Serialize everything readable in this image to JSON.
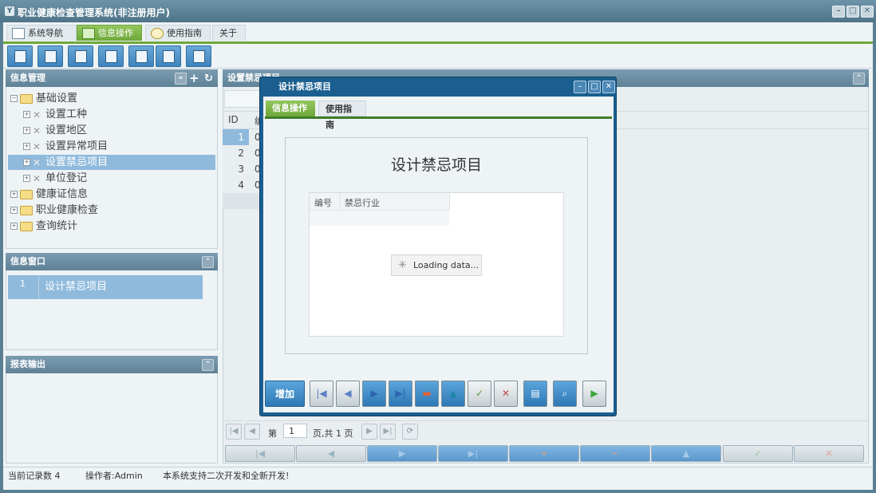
{
  "app": {
    "title": "职业健康检查管理系统(非注册用户)",
    "logo_icon": "app-logo-icon"
  },
  "menu": {
    "tabs": [
      {
        "label": "系统导航",
        "icon": "monitor-icon",
        "active": false
      },
      {
        "label": "信息操作",
        "icon": "grid-icon",
        "active": true
      },
      {
        "label": "使用指南",
        "icon": "help-circle-icon",
        "active": false
      },
      {
        "label": "关于",
        "icon": "",
        "active": false
      }
    ]
  },
  "toolbar": {
    "buttons": [
      "search-doc-icon",
      "book-icon",
      "document-icon",
      "users-icon",
      "window-icon",
      "export-icon",
      "print-icon"
    ]
  },
  "left_panel": {
    "info_manage_title": "信息管理",
    "tree": [
      {
        "label": "基础设置",
        "level": 0,
        "expanded": true,
        "type": "folder"
      },
      {
        "label": "设置工种",
        "level": 1,
        "type": "tool"
      },
      {
        "label": "设置地区",
        "level": 1,
        "type": "tool"
      },
      {
        "label": "设置异常项目",
        "level": 1,
        "type": "tool"
      },
      {
        "label": "设置禁忌项目",
        "level": 1,
        "type": "tool",
        "selected": true
      },
      {
        "label": "单位登记",
        "level": 1,
        "type": "tool"
      },
      {
        "label": "健康证信息",
        "level": 0,
        "type": "folder"
      },
      {
        "label": "职业健康检查",
        "level": 0,
        "type": "folder"
      },
      {
        "label": "查询统计",
        "level": 0,
        "type": "folder"
      }
    ],
    "info_window_title": "信息窗口",
    "info_window_rows": [
      {
        "num": "1",
        "label": "设计禁忌项目"
      }
    ],
    "report_title": "报表输出"
  },
  "right_panel": {
    "title": "设置禁忌项目",
    "col_id": "ID",
    "col_2_partial": "编",
    "rows": [
      {
        "num": "1",
        "code": "0"
      },
      {
        "num": "2",
        "code": "0"
      },
      {
        "num": "3",
        "code": "0"
      },
      {
        "num": "4",
        "code": "0"
      }
    ],
    "pager": {
      "page_label": "第",
      "page_value": "1",
      "page_total": "页,共 1 页"
    }
  },
  "dialog": {
    "title": "设计禁忌项目",
    "tabs": [
      {
        "label": "信息操作",
        "active": true
      },
      {
        "label": "使用指南",
        "active": false
      }
    ],
    "heading": "设计禁忌项目",
    "grid_cols": [
      "编号",
      "禁忌行业"
    ],
    "loading_text": "Loading data...",
    "add_label": "增加"
  },
  "status": {
    "records": "当前记录数 4",
    "operator": "操作者:Admin",
    "note": "本系统支持二次开发和全新开发!"
  },
  "colors": {
    "accent_green": "#6da83a",
    "title_blue": "#1a5f8f",
    "selected_blue": "#8fbadc"
  }
}
